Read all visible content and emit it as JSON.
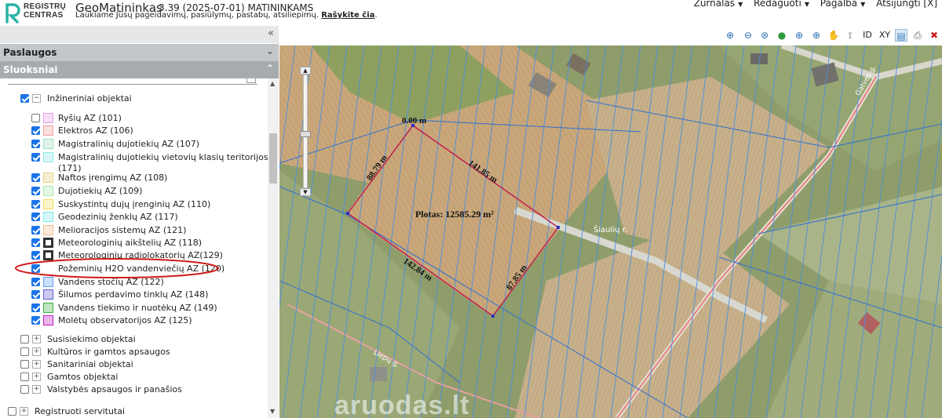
{
  "header": {
    "logo_line1": "REGISTRŲ",
    "logo_line2": "CENTRAS",
    "title": "GeoMatininkas",
    "version": "3.39 (2025-07-01) MATININKAMS",
    "subtitle": "Laukiame Jūsų pageidavimų, pasiūlymų, pastabų, atsiliepimų.",
    "subtitle_link": "Rašykite čia",
    "menu": [
      "Žurnalas",
      "Redaguoti",
      "Pagalba",
      "Atsijungti [X]"
    ]
  },
  "sidebar": {
    "paslaugos": "Paslaugos",
    "sluoksniai": "Sluoksniai",
    "group_inz": "Inžineriniai objektai",
    "layers": [
      {
        "label": "Ryšių AZ (101)",
        "checked": false,
        "color": "#e6a0e6"
      },
      {
        "label": "Elektros AZ (106)",
        "checked": true,
        "color": "#f0a0a0"
      },
      {
        "label": "Magistralinių dujotiekių AZ (107)",
        "checked": true,
        "color": "#a0e0c0"
      },
      {
        "label": "Magistralinių dujotiekių vietovių klasių teritorijos",
        "label2": "(171)",
        "checked": true,
        "color": "#90e8e8"
      },
      {
        "label": "Naftos įrengimų AZ (108)",
        "checked": true,
        "color": "#e8d080"
      },
      {
        "label": "Dujotiekių AZ (109)",
        "checked": true,
        "color": "#b0e8b0"
      },
      {
        "label": "Suskystintų dujų įrenginių AZ (110)",
        "checked": true,
        "color": "#f0e060"
      },
      {
        "label": "Geodezinių ženklų AZ (117)",
        "checked": true,
        "color": "#80e8e8"
      },
      {
        "label": "Melioracijos sistemų AZ (121)",
        "checked": true,
        "color": "#f0c090"
      },
      {
        "label": "Meteorologinių aikštelių AZ (118)",
        "checked": true,
        "color": "#333333"
      },
      {
        "label": "Meteorologinių radiolokatorių AZ(129)",
        "checked": true,
        "color": "#333333"
      },
      {
        "label": "Požeminių H2O vandenviečių AZ (120)",
        "checked": true,
        "color": "#ffffff"
      },
      {
        "label": "Vandens stočių AZ (122)",
        "checked": true,
        "color": "#60a0f0"
      },
      {
        "label": "Šilumos perdavimo tinklų AZ (148)",
        "checked": true,
        "color": "#6060d0"
      },
      {
        "label": "Vandens tiekimo ir nuotėkų AZ (149)",
        "checked": true,
        "color": "#40b040"
      },
      {
        "label": "Molėtų observatorijos AZ (125)",
        "checked": true,
        "color": "#c020c0"
      }
    ],
    "groups": [
      "Susisiekimo objektai",
      "Kultūros ir gamtos apsaugos",
      "Sanitariniai objektai",
      "Gamtos objektai",
      "Valstybės apsaugos ir panašios"
    ],
    "registered": "Registruoti servitutai"
  },
  "toolbar": {
    "id": "ID",
    "xy": "XY"
  },
  "map": {
    "label_corner": "0.00 m",
    "side_nw": "88.79 m",
    "side_ne": "141.85 m",
    "side_sw": "142.84 m",
    "side_se": "87.85 m",
    "area": "Plotas: 12585.29 m²",
    "road1": "Šiaulių r.",
    "road2": "Liepų g.",
    "road3": "Gatvės g."
  },
  "watermark": "aruodas.lt"
}
